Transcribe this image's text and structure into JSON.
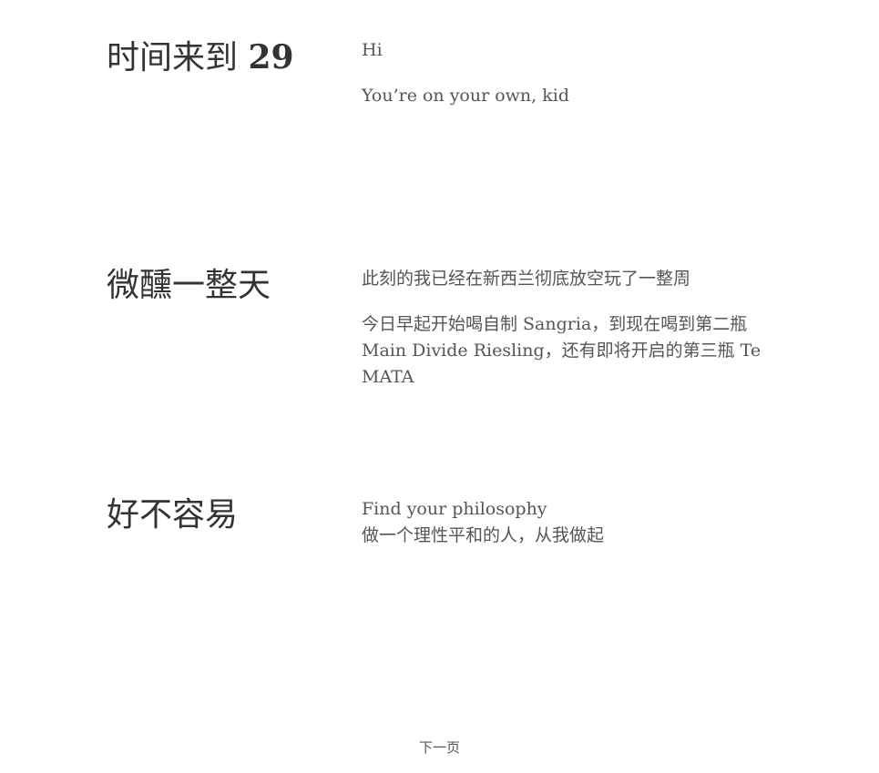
{
  "posts": [
    {
      "title_text": "时间来到 ",
      "title_number": "29",
      "paragraphs": [
        "Hi",
        "You’re on your own, kid"
      ]
    },
    {
      "title_text": "微醺一整天",
      "paragraphs": [
        "此刻的我已经在新西兰彻底放空玩了一整周",
        "今日早起开始喝自制 Sangria，到现在喝到第二瓶 Main Divide Riesling，还有即将开启的第三瓶 Te MATA"
      ]
    },
    {
      "title_text": "好不容易",
      "lines": [
        "Find your philosophy",
        "做一个理性平和的人，从我做起"
      ]
    }
  ],
  "pager": {
    "next_label": "下一页"
  }
}
